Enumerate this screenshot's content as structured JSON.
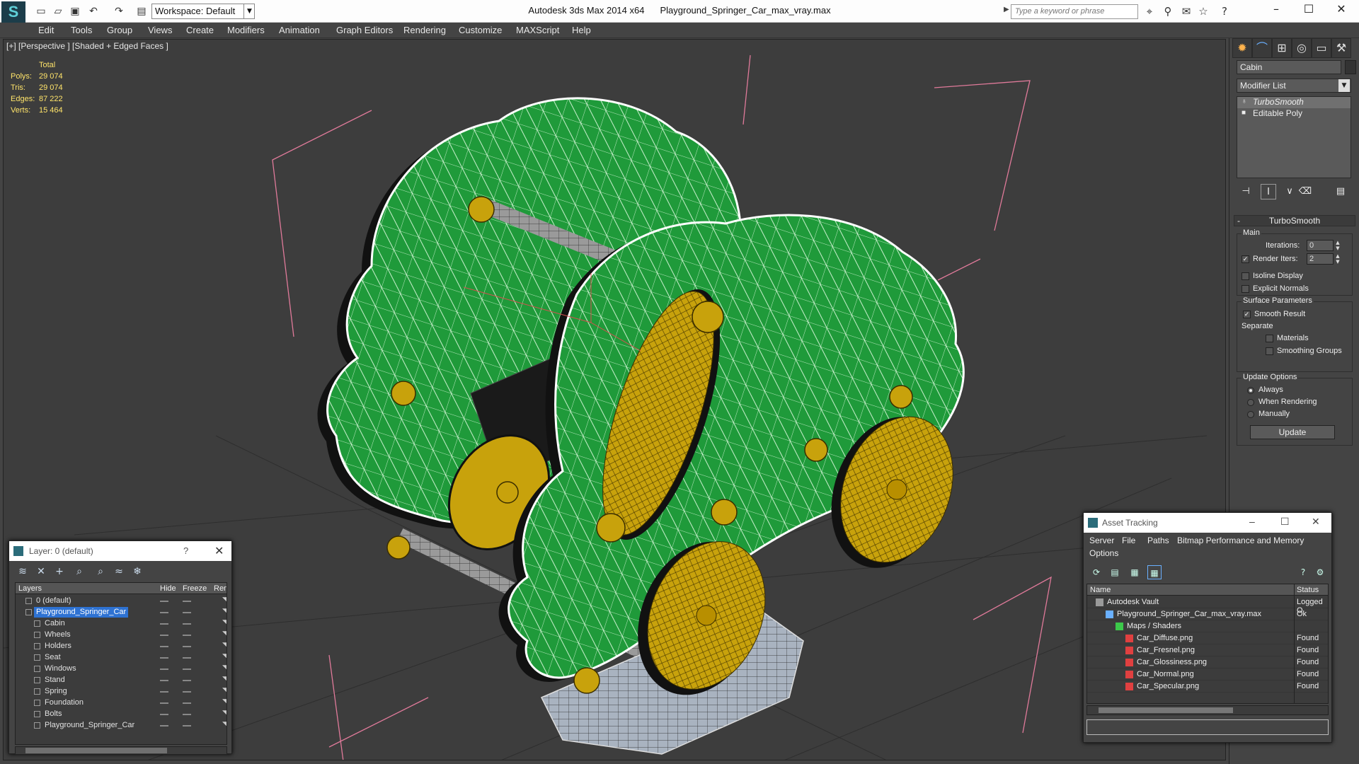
{
  "titlebar": {
    "app_name": "Autodesk 3ds Max  2014 x64",
    "file_name": "Playground_Springer_Car_max_vray.max",
    "workspace": "Workspace: Default",
    "search_placeholder": "Type a keyword or phrase"
  },
  "menu": [
    "Edit",
    "Tools",
    "Group",
    "Views",
    "Create",
    "Modifiers",
    "Animation",
    "Graph Editors",
    "Rendering",
    "Customize",
    "MAXScript",
    "Help"
  ],
  "viewport": {
    "label": "[+] [Perspective ] [Shaded + Edged Faces ]",
    "stats": {
      "header": "Total",
      "polys_label": "Polys:",
      "polys": "29 074",
      "tris_label": "Tris:",
      "tris": "29 074",
      "edges_label": "Edges:",
      "edges": "87 222",
      "verts_label": "Verts:",
      "verts": "15 464"
    }
  },
  "command_panel": {
    "object_name": "Cabin",
    "modifier_list": "Modifier List",
    "stack": [
      "TurboSmooth",
      "Editable Poly"
    ],
    "rollout_title": "TurboSmooth",
    "main_group": "Main",
    "iterations_label": "Iterations:",
    "iterations_value": "0",
    "render_iters_label": "Render Iters:",
    "render_iters_value": "2",
    "isoline_label": "Isoline Display",
    "explicit_normals_label": "Explicit Normals",
    "surface_group": "Surface Parameters",
    "smooth_result_label": "Smooth Result",
    "separate_label": "Separate",
    "materials_label": "Materials",
    "smoothing_groups_label": "Smoothing Groups",
    "update_group": "Update Options",
    "always_label": "Always",
    "when_rendering_label": "When Rendering",
    "manually_label": "Manually",
    "update_button": "Update"
  },
  "layer_dialog": {
    "title": "Layer: 0 (default)",
    "help": "?",
    "columns": {
      "layers": "Layers",
      "hide": "Hide",
      "freeze": "Freeze",
      "render": "Ren"
    },
    "rows": [
      {
        "name": "0 (default)",
        "level": 0
      },
      {
        "name": "Playground_Springer_Car",
        "level": 0
      },
      {
        "name": "Cabin",
        "level": 1
      },
      {
        "name": "Wheels",
        "level": 1
      },
      {
        "name": "Holders",
        "level": 1
      },
      {
        "name": "Seat",
        "level": 1
      },
      {
        "name": "Windows",
        "level": 1
      },
      {
        "name": "Stand",
        "level": 1
      },
      {
        "name": "Spring",
        "level": 1
      },
      {
        "name": "Foundation",
        "level": 1
      },
      {
        "name": "Bolts",
        "level": 1
      },
      {
        "name": "Playground_Springer_Car",
        "level": 1
      }
    ]
  },
  "asset_dialog": {
    "title": "Asset Tracking",
    "menu": [
      "Server",
      "File",
      "Paths",
      "Bitmap Performance and Memory",
      "Options"
    ],
    "columns": {
      "name": "Name",
      "status": "Status"
    },
    "rows": [
      {
        "name": "Autodesk Vault",
        "status": "Logged O",
        "level": 0
      },
      {
        "name": "Playground_Springer_Car_max_vray.max",
        "status": "Ok",
        "level": 1
      },
      {
        "name": "Maps / Shaders",
        "status": "",
        "level": 2
      },
      {
        "name": "Car_Diffuse.png",
        "status": "Found",
        "level": 3
      },
      {
        "name": "Car_Fresnel.png",
        "status": "Found",
        "level": 3
      },
      {
        "name": "Car_Glossiness.png",
        "status": "Found",
        "level": 3
      },
      {
        "name": "Car_Normal.png",
        "status": "Found",
        "level": 3
      },
      {
        "name": "Car_Specular.png",
        "status": "Found",
        "level": 3
      }
    ]
  },
  "colors": {
    "body_green": "#1f9a3a",
    "wheel_yellow": "#c8a20c",
    "stats_yellow": "#ffe46a",
    "selection_blue": "#2e72d2",
    "bbox_pink": "#e07a9a"
  }
}
